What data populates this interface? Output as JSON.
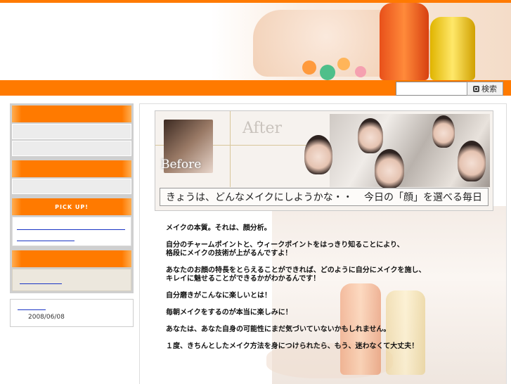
{
  "header": {
    "brand_color": "#ff7a00"
  },
  "search": {
    "placeholder": "",
    "button_label": "検索"
  },
  "sidebar": {
    "pickup_label": "PICK UP!",
    "date": "2008/06/08"
  },
  "banner": {
    "after_label": "After",
    "before_label": "Before",
    "caption_left": "きょうは、どんなメイクにしようかな・・",
    "caption_right": "今日の「顔」を選べる毎日"
  },
  "content": {
    "lines": [
      "メイクの本質。それは、顔分析。",
      "",
      "自分のチャームポイントと、ウィークポイントをはっきり知ることにより、",
      "格段にメイクの技術が上がるんですよ！",
      "",
      "あなたのお顔の特長をとらえることができれば、どのように自分にメイクを施し、",
      "キレイに魅せることができるかがわかるんです！",
      "",
      "自分磨きがこんなに楽しいとは！",
      "",
      "毎朝メイクをするのが本当に楽しみに！",
      "",
      "あなたは、あなた自身の可能性にまだ気づいていないかもしれません。",
      "",
      "１度、きちんとしたメイク方法を身につけられたら、もう、迷わなくて大丈夫！"
    ]
  }
}
